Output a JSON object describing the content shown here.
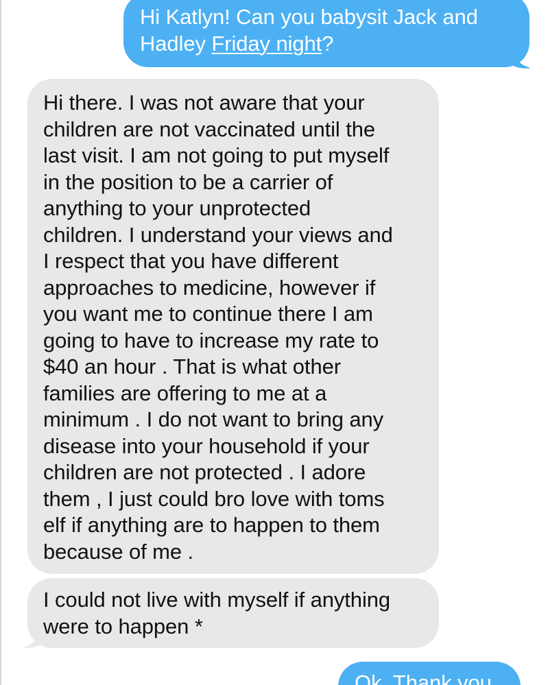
{
  "conversation": {
    "messages": [
      {
        "direction": "sent",
        "lines": [
          {
            "text": "Hi Katlyn! Can you babysit Jack and"
          },
          {
            "before": "Hadley ",
            "link": "Friday night",
            "after": "?"
          }
        ]
      },
      {
        "direction": "received",
        "lines": [
          "Hi there. I was not aware that your",
          "children are not vaccinated until the",
          "last visit. I am not going to put myself",
          "in the position to be a carrier of",
          "anything to your unprotected",
          "children. I understand your views and",
          "I respect that you have different",
          "approaches to medicine, however if",
          "you want me to continue there I am",
          "going to have to increase my rate to",
          "$40 an hour . That is what other",
          "families are offering to me at a",
          "minimum . I do not want to bring any",
          "disease into your household if your",
          "children are not protected . I adore",
          "them , I just could bro love with toms",
          "elf if anything are to happen to them",
          "because of me ."
        ]
      },
      {
        "direction": "received",
        "lines": [
          "I could not live with myself if anything",
          "were to happen *"
        ]
      },
      {
        "direction": "sent",
        "lines": [
          "Ok. Thank you"
        ]
      }
    ]
  },
  "colors": {
    "sent_bubble": "#4cb0f3",
    "received_bubble": "#e8e8ea",
    "sent_text": "#ffffff",
    "received_text": "#111111",
    "background": "#ffffff"
  }
}
